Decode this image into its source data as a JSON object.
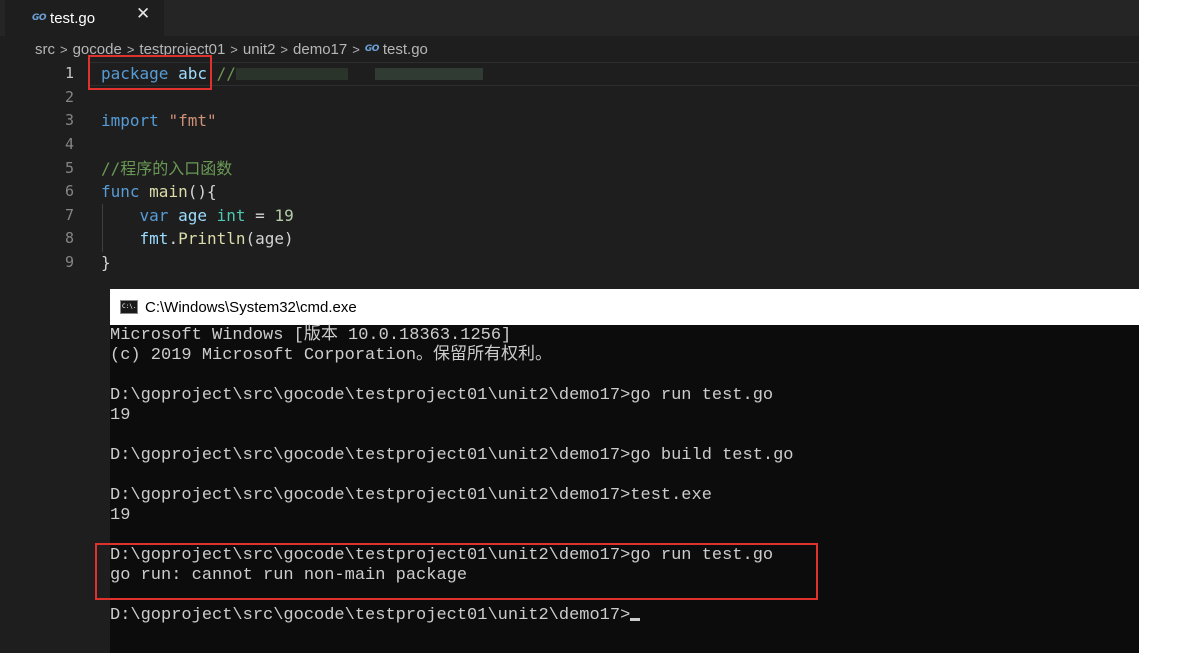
{
  "editor": {
    "tab": {
      "icon": "go-file-icon",
      "icon_text": "GO",
      "label": "test.go",
      "close": "✕"
    },
    "breadcrumb": {
      "items": [
        "src",
        "gocode",
        "testproject01",
        "unit2",
        "demo17"
      ],
      "separator": ">",
      "file_icon_text": "GO",
      "file": "test.go"
    },
    "line_numbers": [
      "1",
      "2",
      "3",
      "4",
      "5",
      "6",
      "7",
      "8",
      "9"
    ],
    "code": {
      "l1_package": "package",
      "l1_name": "abc",
      "l1_comment": "//",
      "l3_import": "import",
      "l3_path": "\"fmt\"",
      "l5_comment": "//程序的入口函数",
      "l6_func": "func",
      "l6_name": "main",
      "l6_rest": "(){",
      "l7_var": "var",
      "l7_ident": "age",
      "l7_type": "int",
      "l7_eq": " = ",
      "l7_value": "19",
      "l8_pkg": "fmt",
      "l8_dot": ".",
      "l8_fn": "Println",
      "l8_args": "(age)",
      "l9_close": "}"
    },
    "colors": {
      "keyword": "#569cd6",
      "function": "#dcdcaa",
      "string": "#ce9178",
      "comment": "#6a9955",
      "identifier": "#9cdcfe",
      "type": "#4ec9b0",
      "number": "#b5cea8",
      "highlight_box": "#e0322c"
    }
  },
  "cmd": {
    "icon_text": "C:\\.",
    "title": "C:\\Windows\\System32\\cmd.exe",
    "lines": [
      "Microsoft Windows [版本 10.0.18363.1256]",
      "(c) 2019 Microsoft Corporation。保留所有权利。",
      "",
      "D:\\goproject\\src\\gocode\\testproject01\\unit2\\demo17>go run test.go",
      "19",
      "",
      "D:\\goproject\\src\\gocode\\testproject01\\unit2\\demo17>go build test.go",
      "",
      "D:\\goproject\\src\\gocode\\testproject01\\unit2\\demo17>test.exe",
      "19",
      "",
      "D:\\goproject\\src\\gocode\\testproject01\\unit2\\demo17>go run test.go",
      "go run: cannot run non-main package",
      "",
      "D:\\goproject\\src\\gocode\\testproject01\\unit2\\demo17>"
    ]
  }
}
